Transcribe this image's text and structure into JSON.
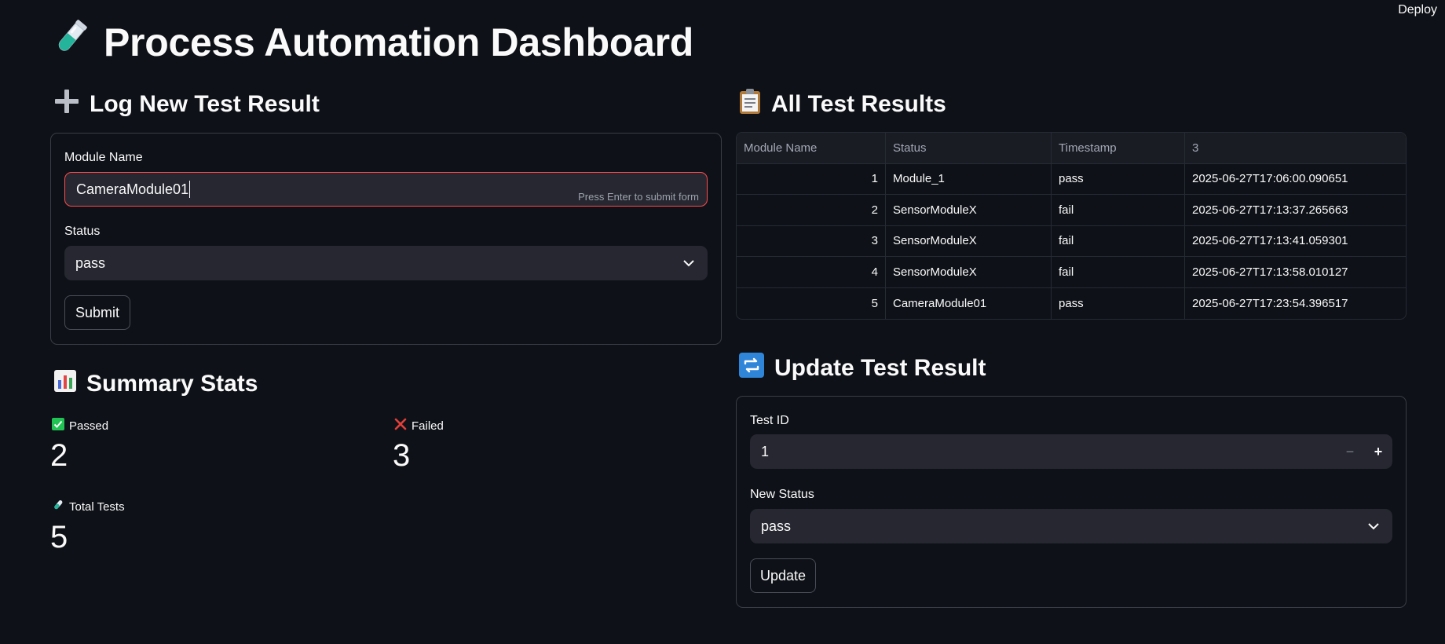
{
  "header": {
    "deploy_label": "Deploy",
    "title": "Process Automation Dashboard",
    "title_icon": "test-tube-icon"
  },
  "log_section": {
    "heading": "Log New Test Result",
    "heading_icon": "plus-icon",
    "module_name_label": "Module Name",
    "module_name_value": "CameraModule01",
    "module_name_hint": "Press Enter to submit form",
    "status_label": "Status",
    "status_value": "pass",
    "submit_label": "Submit"
  },
  "summary_section": {
    "heading": "Summary Stats",
    "heading_icon": "bar-chart-icon",
    "passed_label": "Passed",
    "passed_value": "2",
    "failed_label": "Failed",
    "failed_value": "3",
    "total_label": "Total Tests",
    "total_value": "5"
  },
  "results_section": {
    "heading": "All Test Results",
    "heading_icon": "clipboard-icon",
    "columns": [
      "Module Name",
      "Status",
      "Timestamp",
      "3"
    ],
    "rows": [
      [
        "1",
        "Module_1",
        "pass",
        "2025-06-27T17:06:00.090651"
      ],
      [
        "2",
        "SensorModuleX",
        "fail",
        "2025-06-27T17:13:37.265663"
      ],
      [
        "3",
        "SensorModuleX",
        "fail",
        "2025-06-27T17:13:41.059301"
      ],
      [
        "4",
        "SensorModuleX",
        "fail",
        "2025-06-27T17:13:58.010127"
      ],
      [
        "5",
        "CameraModule01",
        "pass",
        "2025-06-27T17:23:54.396517"
      ]
    ]
  },
  "update_section": {
    "heading": "Update Test Result",
    "heading_icon": "repeat-icon",
    "test_id_label": "Test ID",
    "test_id_value": "1",
    "minus_label": "−",
    "plus_label": "+",
    "new_status_label": "New Status",
    "new_status_value": "pass",
    "update_label": "Update"
  },
  "colors": {
    "background": "#0e1117",
    "input_bg": "#262730",
    "accent_red": "#ff4b4b",
    "pass_green": "#21c354",
    "fail_red": "#e0403a"
  }
}
